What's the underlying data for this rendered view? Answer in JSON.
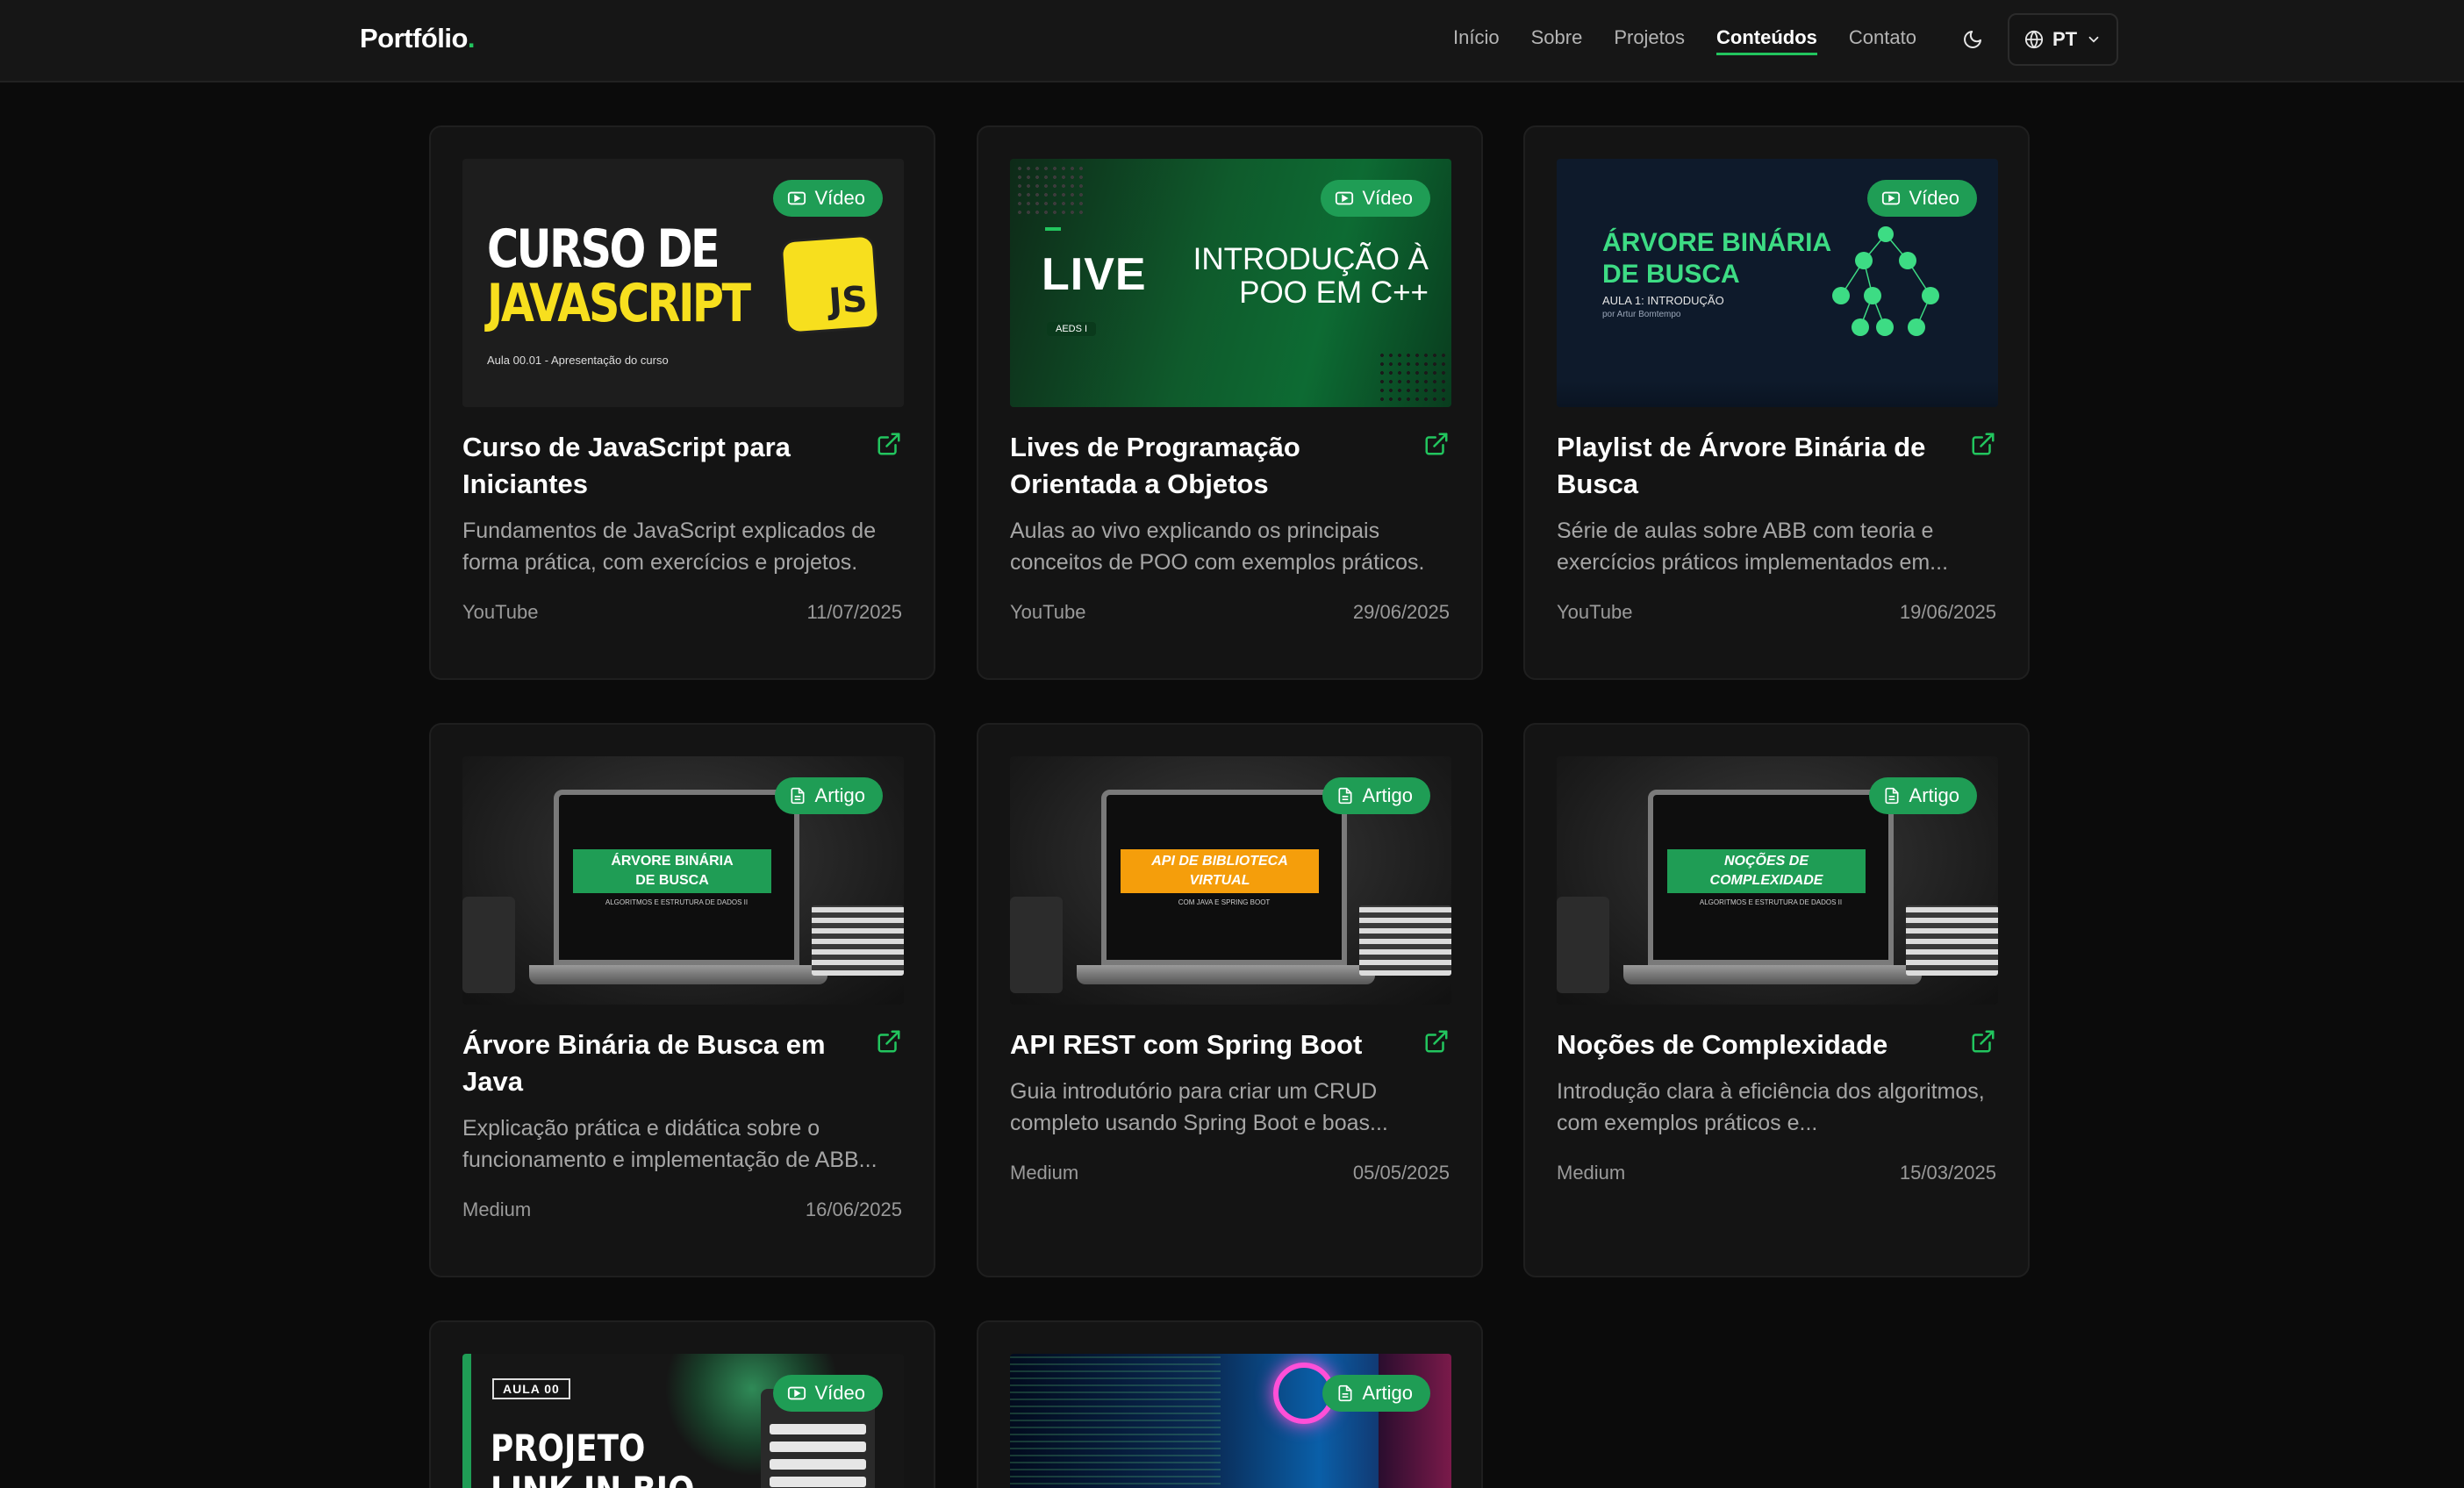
{
  "header": {
    "logo": "Portfólio",
    "logo_dot": ".",
    "nav": [
      {
        "label": "Início"
      },
      {
        "label": "Sobre"
      },
      {
        "label": "Projetos"
      },
      {
        "label": "Conteúdos",
        "active": true
      },
      {
        "label": "Contato"
      }
    ],
    "language": "PT"
  },
  "colors": {
    "accent": "#22c55e",
    "badge": "#1f9d55",
    "background": "#0b0b0b",
    "card": "#141414"
  },
  "cards": [
    {
      "badge": "Vídeo",
      "badge_icon": "video-icon",
      "title": "Curso de JavaScript para Iniciantes",
      "description": "Fundamentos de JavaScript explicados de forma prática, com exercícios e projetos.",
      "platform": "YouTube",
      "date": "11/07/2025",
      "thumb": {
        "line1": "CURSO DE",
        "line2": "JAVASCRIPT",
        "caption": "Aula 00.01 - Apresentação do curso",
        "logo": "JS"
      }
    },
    {
      "badge": "Vídeo",
      "badge_icon": "video-icon",
      "title": "Lives de Programação Orientada a Objetos",
      "description": "Aulas ao vivo explicando os principais conceitos de POO com exemplos práticos.",
      "platform": "YouTube",
      "date": "29/06/2025",
      "thumb": {
        "live": "LIVE",
        "tag": "AEDS I",
        "line1": "INTRODUÇÃO À",
        "line2": "POO EM C++"
      }
    },
    {
      "badge": "Vídeo",
      "badge_icon": "video-icon",
      "title": "Playlist de Árvore Binária de Busca",
      "description": "Série de aulas sobre ABB com teoria e exercícios práticos implementados em...",
      "platform": "YouTube",
      "date": "19/06/2025",
      "thumb": {
        "line1": "ÁRVORE BINÁRIA",
        "line2": "DE BUSCA",
        "sub": "AULA 1: INTRODUÇÃO",
        "author": "por Artur Bomtempo"
      }
    },
    {
      "badge": "Artigo",
      "badge_icon": "document-icon",
      "title": "Árvore Binária de Busca em Java",
      "description": "Explicação prática e didática sobre o funcionamento e implementação de ABB...",
      "platform": "Medium",
      "date": "16/06/2025",
      "thumb": {
        "line1": "ÁRVORE BINÁRIA",
        "line2": "DE BUSCA",
        "sub": "ALGORITMOS E ESTRUTURA DE DADOS II",
        "color": "#1f9d55"
      }
    },
    {
      "badge": "Artigo",
      "badge_icon": "document-icon",
      "title": "API REST com Spring Boot",
      "description": "Guia introdutório para criar um CRUD completo usando Spring Boot e boas...",
      "platform": "Medium",
      "date": "05/05/2025",
      "thumb": {
        "line1": "API DE BIBLIOTECA",
        "line2": "VIRTUAL",
        "sub": "COM JAVA E SPRING BOOT",
        "color": "#f59e0b"
      }
    },
    {
      "badge": "Artigo",
      "badge_icon": "document-icon",
      "title": "Noções de Complexidade",
      "description": "Introdução clara à eficiência dos algoritmos, com exemplos práticos e...",
      "platform": "Medium",
      "date": "15/03/2025",
      "thumb": {
        "line1": "NOÇÕES DE",
        "line2": "COMPLEXIDADE",
        "sub": "ALGORITMOS E ESTRUTURA DE DADOS II",
        "color": "#1f9d55"
      }
    },
    {
      "badge": "Vídeo",
      "badge_icon": "video-icon",
      "thumb": {
        "tag": "AULA 00",
        "line1": "PROJETO",
        "line2": "LINK IN BIO"
      }
    },
    {
      "badge": "Artigo",
      "badge_icon": "document-icon"
    }
  ]
}
